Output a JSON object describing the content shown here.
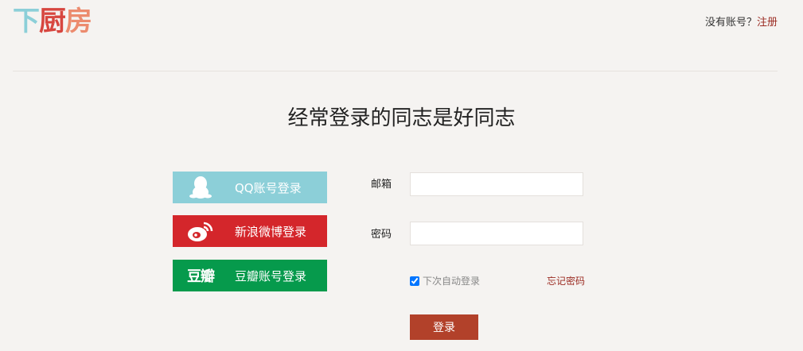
{
  "logo": {
    "part1": "下",
    "part2": "厨",
    "part3": "房"
  },
  "header": {
    "no_account": "没有账号？",
    "register": "注册"
  },
  "headline": "经常登录的同志是好同志",
  "social": {
    "qq": "QQ账号登录",
    "weibo": "新浪微博登录",
    "douban_mark": "豆瓣",
    "douban": "豆瓣账号登录"
  },
  "form": {
    "email_label": "邮箱",
    "email_value": "",
    "password_label": "密码",
    "password_value": "",
    "remember": "下次自动登录",
    "forgot": "忘记密码",
    "submit": "登录"
  },
  "colors": {
    "qq": "#8ccfd8",
    "weibo": "#d4262b",
    "douban": "#069a4c",
    "submit": "#b2412a",
    "link": "#9b2b22"
  }
}
